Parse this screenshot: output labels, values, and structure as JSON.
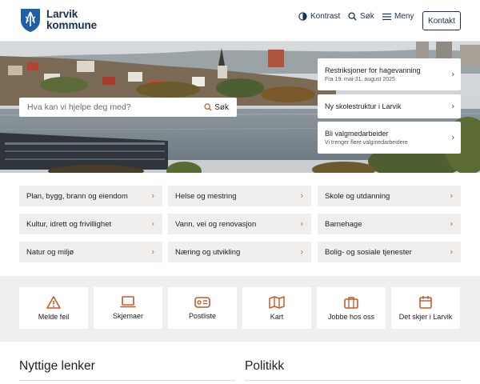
{
  "header": {
    "logo_line1": "Larvik",
    "logo_line2": "kommune",
    "contrast_label": "Kontrast",
    "search_label": "Søk",
    "menu_label": "Meny",
    "contact_label": "Kontakt"
  },
  "hero": {
    "search_placeholder": "Hva kan vi hjelpe deg med?",
    "search_button": "Søk",
    "news": [
      {
        "title": "Restriksjoner for hagevanning",
        "subtitle": "Fra 19. mai-31. august 2025"
      },
      {
        "title": "Ny skolestruktur i Larvik",
        "subtitle": ""
      },
      {
        "title": "Bli valgmedarbeider",
        "subtitle": "Vi trenger flere valgmedarbeidere"
      }
    ]
  },
  "services": [
    "Plan, bygg, brann og eiendom",
    "Helse og mestring",
    "Skole og utdanning",
    "Kultur, idrett og frivillighet",
    "Vann, vei og renovasjon",
    "Barnehage",
    "Natur og miljø",
    "Næring og utvikling",
    "Bolig- og sosiale tjenester"
  ],
  "quick_links": [
    {
      "label": "Melde feil",
      "icon": "warning-icon"
    },
    {
      "label": "Skjemaer",
      "icon": "laptop-icon"
    },
    {
      "label": "Postliste",
      "icon": "mailbox-icon"
    },
    {
      "label": "Kart",
      "icon": "map-icon"
    },
    {
      "label": "Jobbe hos oss",
      "icon": "briefcase-icon"
    },
    {
      "label": "Det skjer i Larvik",
      "icon": "calendar-icon"
    }
  ],
  "sections": {
    "useful_links": "Nyttige lenker",
    "politics": "Politikk"
  },
  "colors": {
    "brand_navy": "#1b2f4e",
    "accent_orange": "#c25a2b",
    "tile_bg": "#f1efed"
  }
}
